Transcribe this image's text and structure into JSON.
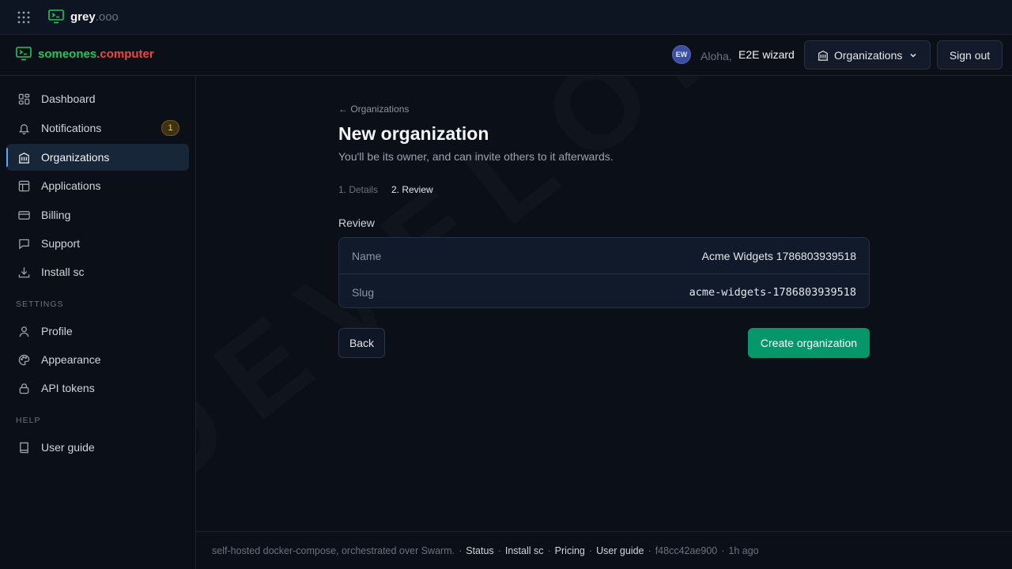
{
  "topbar": {
    "brand_name": "grey",
    "brand_tld": ".ooo",
    "icons": {
      "apps": "grid-icon",
      "logo": "terminal-screen-icon"
    }
  },
  "header": {
    "brand_name": "someones",
    "brand_dot": ".",
    "brand_tld": "computer",
    "avatar_initials": "EW",
    "greeting": "Aloha,",
    "username": "E2E wizard",
    "org_dropdown_label": "Organizations",
    "signout_label": "Sign out"
  },
  "sidebar": {
    "items": [
      {
        "label": "Dashboard",
        "icon": "dashboard-icon"
      },
      {
        "label": "Notifications",
        "icon": "bell-icon",
        "badge": "1"
      },
      {
        "label": "Organizations",
        "icon": "building-icon",
        "active": true
      },
      {
        "label": "Applications",
        "icon": "layout-icon"
      },
      {
        "label": "Billing",
        "icon": "credit-card-icon"
      },
      {
        "label": "Support",
        "icon": "chat-icon"
      },
      {
        "label": "Install sc",
        "icon": "download-icon"
      }
    ],
    "settings_label": "SETTINGS",
    "settings_items": [
      {
        "label": "Profile",
        "icon": "user-icon"
      },
      {
        "label": "Appearance",
        "icon": "palette-icon"
      },
      {
        "label": "API tokens",
        "icon": "lock-icon"
      }
    ],
    "help_label": "HELP",
    "help_items": [
      {
        "label": "User guide",
        "icon": "book-icon"
      }
    ]
  },
  "main": {
    "breadcrumb": "← Organizations",
    "title": "New organization",
    "subtitle": "You'll be its owner, and can invite others to it afterwards.",
    "steps": [
      "1. Details",
      "2. Review"
    ],
    "review_label": "Review",
    "review": [
      {
        "key": "Name",
        "value": "Acme Widgets 1786803939518"
      },
      {
        "key": "Slug",
        "value": "acme-widgets-1786803939518"
      }
    ],
    "back_label": "Back",
    "create_label": "Create organization",
    "watermark": "DEVELOPMENT"
  },
  "footer": {
    "text": "self-hosted docker-compose, orchestrated over Swarm.",
    "links": [
      "Status",
      "Install sc",
      "Pricing",
      "User guide"
    ],
    "commit": "f48cc42ae900",
    "age": "1h ago",
    "separator": "·"
  },
  "colors": {
    "background": "#0b0f17",
    "accent_green": "#059669",
    "brand_green": "#22c55e",
    "brand_red": "#ef4444",
    "badge_yellow": "#facc15",
    "active_indicator": "#60a5fa"
  }
}
